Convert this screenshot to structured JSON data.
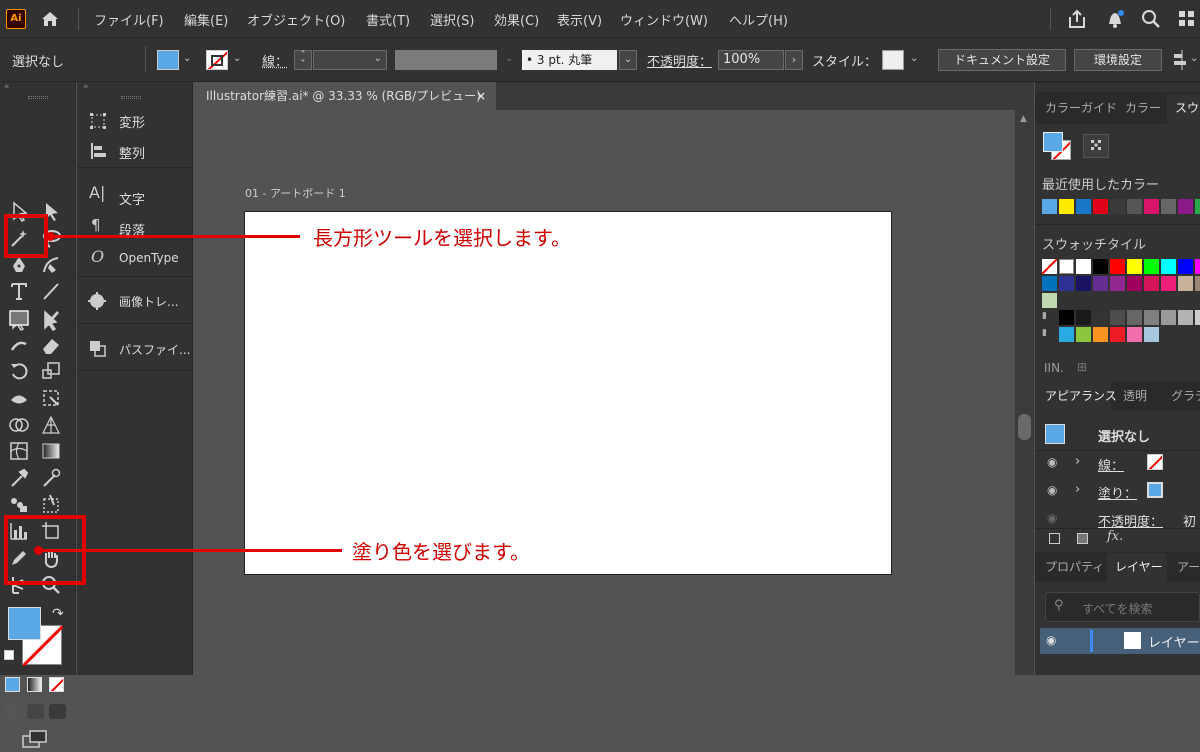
{
  "menubar": {
    "logo": "Ai",
    "items": [
      "ファイル(F)",
      "編集(E)",
      "オブジェクト(O)",
      "書式(T)",
      "選択(S)",
      "効果(C)",
      "表示(V)",
      "ウィンドウ(W)",
      "ヘルプ(H)"
    ]
  },
  "control": {
    "selection": "選択なし",
    "stroke_label": "線：",
    "stroke_style": "3 pt. 丸筆",
    "opacity_label": "不透明度：",
    "opacity_value": "100%",
    "style_label": "スタイル：",
    "doc_settings": "ドキュメント設定",
    "preferences": "環境設定"
  },
  "colors": {
    "fill": "#5aa9e6",
    "accent": "#e00000",
    "bg": "#535353",
    "panel": "#323232"
  },
  "document": {
    "tab_title": "Illustrator練習.ai* @ 33.33 % (RGB/プレビュー)",
    "close": "×",
    "artboard_label": "01 - アートボード 1"
  },
  "side_panel": {
    "items": [
      "変形",
      "整列",
      "文字",
      "段落",
      "OpenType",
      "画像トレ...",
      "パスファイ..."
    ]
  },
  "callouts": {
    "rect_tool": "長方形ツールを選択します。",
    "fill_color": "塗り色を選びます。"
  },
  "right_panel": {
    "tabs_top": [
      "カラーガイド",
      "カラー",
      "スウ"
    ],
    "recent_colors_label": "最近使用したカラー",
    "swatch_tile_label": "スウォッチタイル",
    "tabs_mid": [
      "アピアランス",
      "透明",
      "グラデ"
    ],
    "appearance": {
      "title": "選択なし",
      "stroke": "線：",
      "fill": "塗り：",
      "opacity": "不透明度：",
      "opacity_value": "初"
    },
    "tabs_bottom": [
      "プロパティ",
      "レイヤー",
      "アー"
    ],
    "search_placeholder": "すべてを検索",
    "layer_name": "レイヤー"
  }
}
